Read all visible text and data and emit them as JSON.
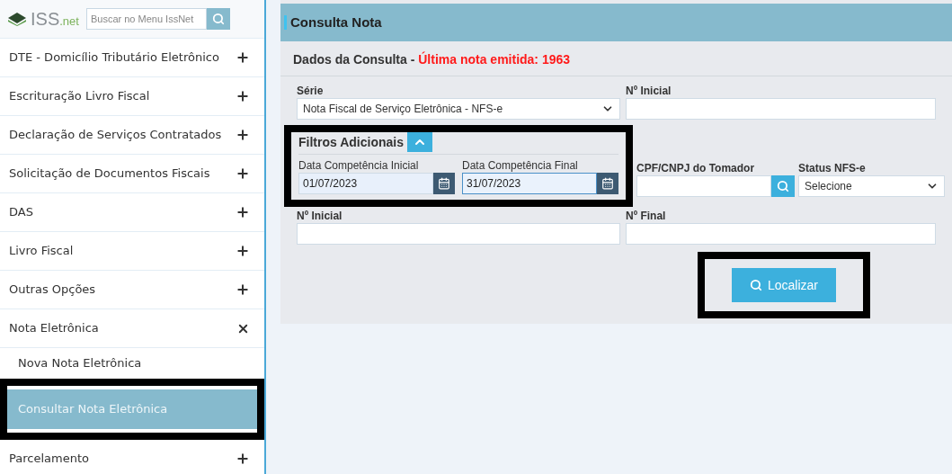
{
  "logo": {
    "text": "ISS",
    "suffix": ".net"
  },
  "search": {
    "placeholder": "Buscar no Menu IssNet"
  },
  "sidebar": {
    "items": [
      {
        "label": "DTE - Domicílio Tributário Eletrônico",
        "expanded": false
      },
      {
        "label": "Escrituração Livro Fiscal",
        "expanded": false
      },
      {
        "label": "Declaração de Serviços Contratados",
        "expanded": false
      },
      {
        "label": "Solicitação de Documentos Fiscais",
        "expanded": false
      },
      {
        "label": "DAS",
        "expanded": false
      },
      {
        "label": "Livro Fiscal",
        "expanded": false
      },
      {
        "label": "Outras Opções",
        "expanded": false
      },
      {
        "label": "Nota Eletrônica",
        "expanded": true,
        "children": [
          {
            "label": "Nova Nota Eletrônica",
            "selected": false
          },
          {
            "label": "Consultar Nota Eletrônica",
            "selected": true
          }
        ]
      },
      {
        "label": "Parcelamento",
        "expanded": false
      }
    ]
  },
  "panel": {
    "title": "Consulta Nota",
    "subtitle": "Dados da Consulta - ",
    "notice": "Última nota emitida: 1963"
  },
  "serie": {
    "label": "Série",
    "value": "Nota Fiscal de Serviço Eletrônica - NFS-e"
  },
  "numero_inicial_top": {
    "label": "Nº Inicial"
  },
  "filters": {
    "title": "Filtros Adicionais",
    "expanded": true
  },
  "data_inicial": {
    "label": "Data Competência Inicial",
    "value": "01/07/2023",
    "focused": false
  },
  "data_final": {
    "label": "Data Competência Final",
    "value": "31/07/2023",
    "focused": true
  },
  "tomador": {
    "label": "CPF/CNPJ do Tomador"
  },
  "status": {
    "label": "Status NFS-e",
    "value": "Selecione"
  },
  "numero_inicial": {
    "label": "Nº Inicial"
  },
  "numero_final": {
    "label": "Nº Final"
  },
  "button": {
    "label": "Localizar"
  }
}
